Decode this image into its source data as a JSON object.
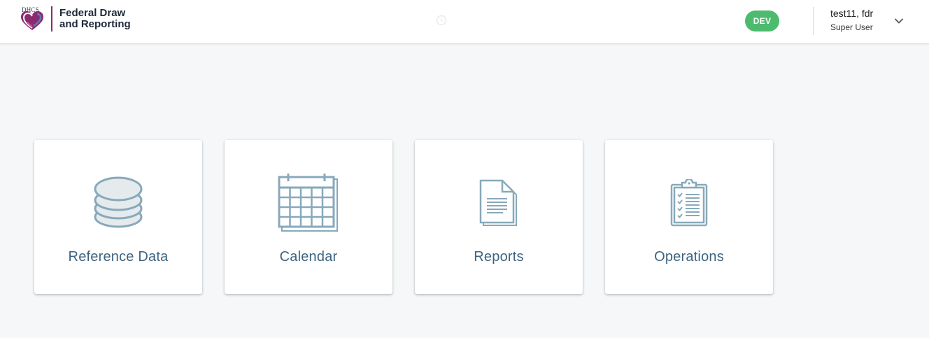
{
  "header": {
    "logo_text": "DHCS",
    "title_line1": "Federal Draw",
    "title_line2": "and Reporting",
    "environment_badge": "DEV",
    "user": {
      "name": "test11, fdr",
      "role": "Super User"
    }
  },
  "icons": {
    "logo": "dhcs-heart-logo",
    "loading": "loading-spinner-icon",
    "user_menu": "chevron-down-icon"
  },
  "tiles": [
    {
      "label": "Reference Data",
      "icon": "database-icon"
    },
    {
      "label": "Calendar",
      "icon": "calendar-icon"
    },
    {
      "label": "Reports",
      "icon": "document-icon"
    },
    {
      "label": "Operations",
      "icon": "clipboard-checklist-icon"
    }
  ],
  "colors": {
    "background": "#f6f7f9",
    "tile_label": "#3d6480",
    "icon_stroke": "#87a9bb",
    "badge": "#4cbb6e",
    "logo_accent": "#8b2b6f"
  }
}
